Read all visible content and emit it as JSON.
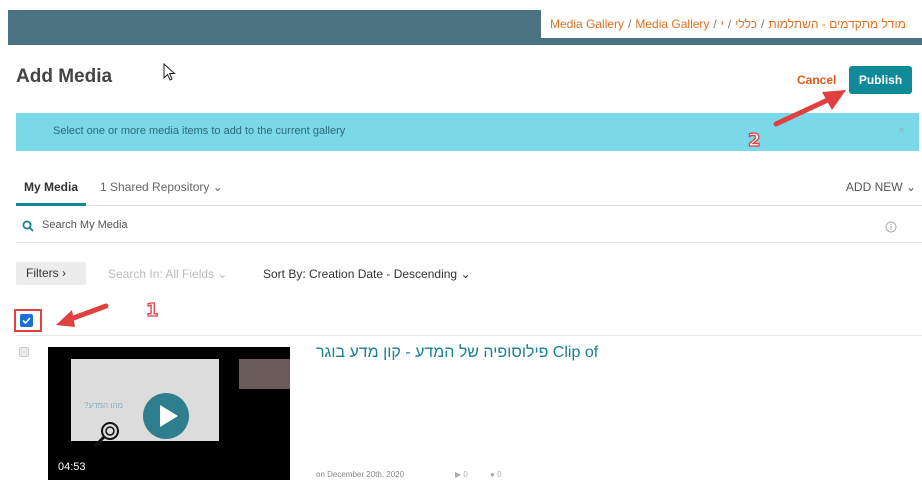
{
  "breadcrumb": {
    "items": [
      "כללי",
      "מודל מתקדמים - השתלמות",
      "Media Gallery",
      "Media Gallery"
    ],
    "leading": "י"
  },
  "header": {
    "title": "Add Media",
    "cancel_label": "Cancel",
    "publish_label": "Publish"
  },
  "banner": {
    "message": "Select one or more media items to add to the current gallery",
    "close_glyph": "×"
  },
  "tabs": {
    "my_media": "My Media",
    "shared": "1 Shared Repository",
    "add_new": "ADD NEW"
  },
  "search": {
    "placeholder": "Search My Media"
  },
  "toolbar": {
    "filters_label": "Filters",
    "search_in": "Search In: All Fields",
    "sort_by": "Sort By: Creation Date - Descending"
  },
  "entry": {
    "title": "פילוסופיה של המדע - קון מדע בוגר Clip of",
    "thumb_text": "מהו המדע?",
    "duration": "04:53",
    "date": "on December 20th, 2020",
    "plays": "0",
    "comments": "0"
  },
  "annotations": {
    "one": "1",
    "two": "2"
  },
  "colors": {
    "accent": "#0e8a98",
    "banner": "#7bd8e8",
    "topbar": "#4a7280",
    "annotation": "#e04040"
  }
}
